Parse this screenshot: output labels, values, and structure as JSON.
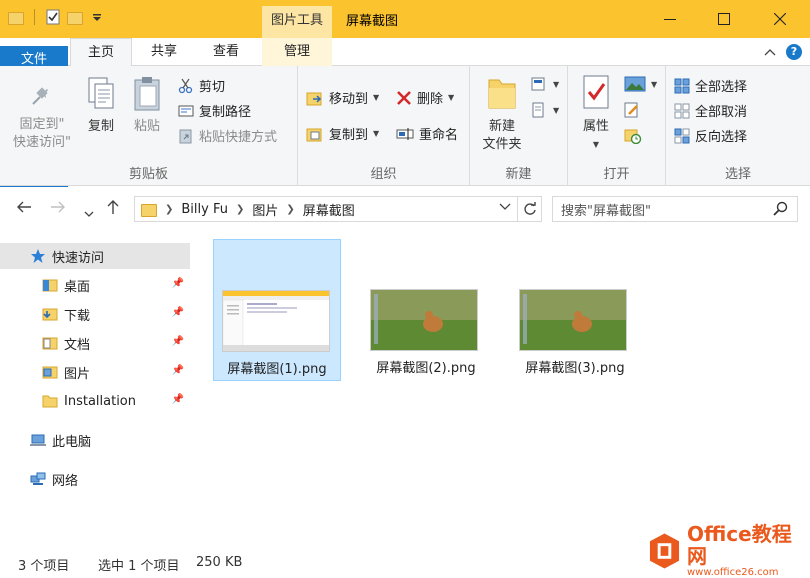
{
  "window": {
    "title": "屏幕截图",
    "context_tab": "图片工具"
  },
  "ribbon_tabs": [
    {
      "label": "文件"
    },
    {
      "label": "主页"
    },
    {
      "label": "共享"
    },
    {
      "label": "查看"
    },
    {
      "label": "管理"
    }
  ],
  "ribbon": {
    "clipboard": {
      "label": "剪贴板",
      "pin": "固定到\"\n快速访问\"",
      "pin_l1": "固定到\"",
      "pin_l2": "快速访问\"",
      "copy": "复制",
      "paste": "粘贴",
      "cut": "剪切",
      "copy_path": "复制路径",
      "paste_shortcut": "粘贴快捷方式"
    },
    "organize": {
      "label": "组织",
      "move_to": "移动到",
      "copy_to": "复制到",
      "delete": "删除",
      "rename": "重命名"
    },
    "new": {
      "label": "新建",
      "new_folder_l1": "新建",
      "new_folder_l2": "文件夹"
    },
    "open": {
      "label": "打开",
      "properties": "属性"
    },
    "select": {
      "label": "选择",
      "select_all": "全部选择",
      "select_none": "全部取消",
      "invert": "反向选择"
    }
  },
  "address": {
    "crumbs": [
      "Billy Fu",
      "图片",
      "屏幕截图"
    ],
    "search_placeholder": "搜索\"屏幕截图\""
  },
  "nav": {
    "quick_access": "快速访问",
    "items": [
      "桌面",
      "下载",
      "文档",
      "图片",
      "Installation"
    ],
    "this_pc": "此电脑",
    "network": "网络"
  },
  "files": [
    {
      "name": "屏幕截图(1).png",
      "selected": true
    },
    {
      "name": "屏幕截图(2).png",
      "selected": false
    },
    {
      "name": "屏幕截图(3).png",
      "selected": false
    }
  ],
  "status": {
    "count": "3 个项目",
    "selected": "选中 1 个项目",
    "size": "250 KB"
  },
  "watermark": {
    "brand": "Office教程网",
    "url": "www.office26.com"
  },
  "colors": {
    "title_bar": "#fbc32e",
    "file_tab": "#1979ca",
    "selection": "#cce8ff"
  }
}
